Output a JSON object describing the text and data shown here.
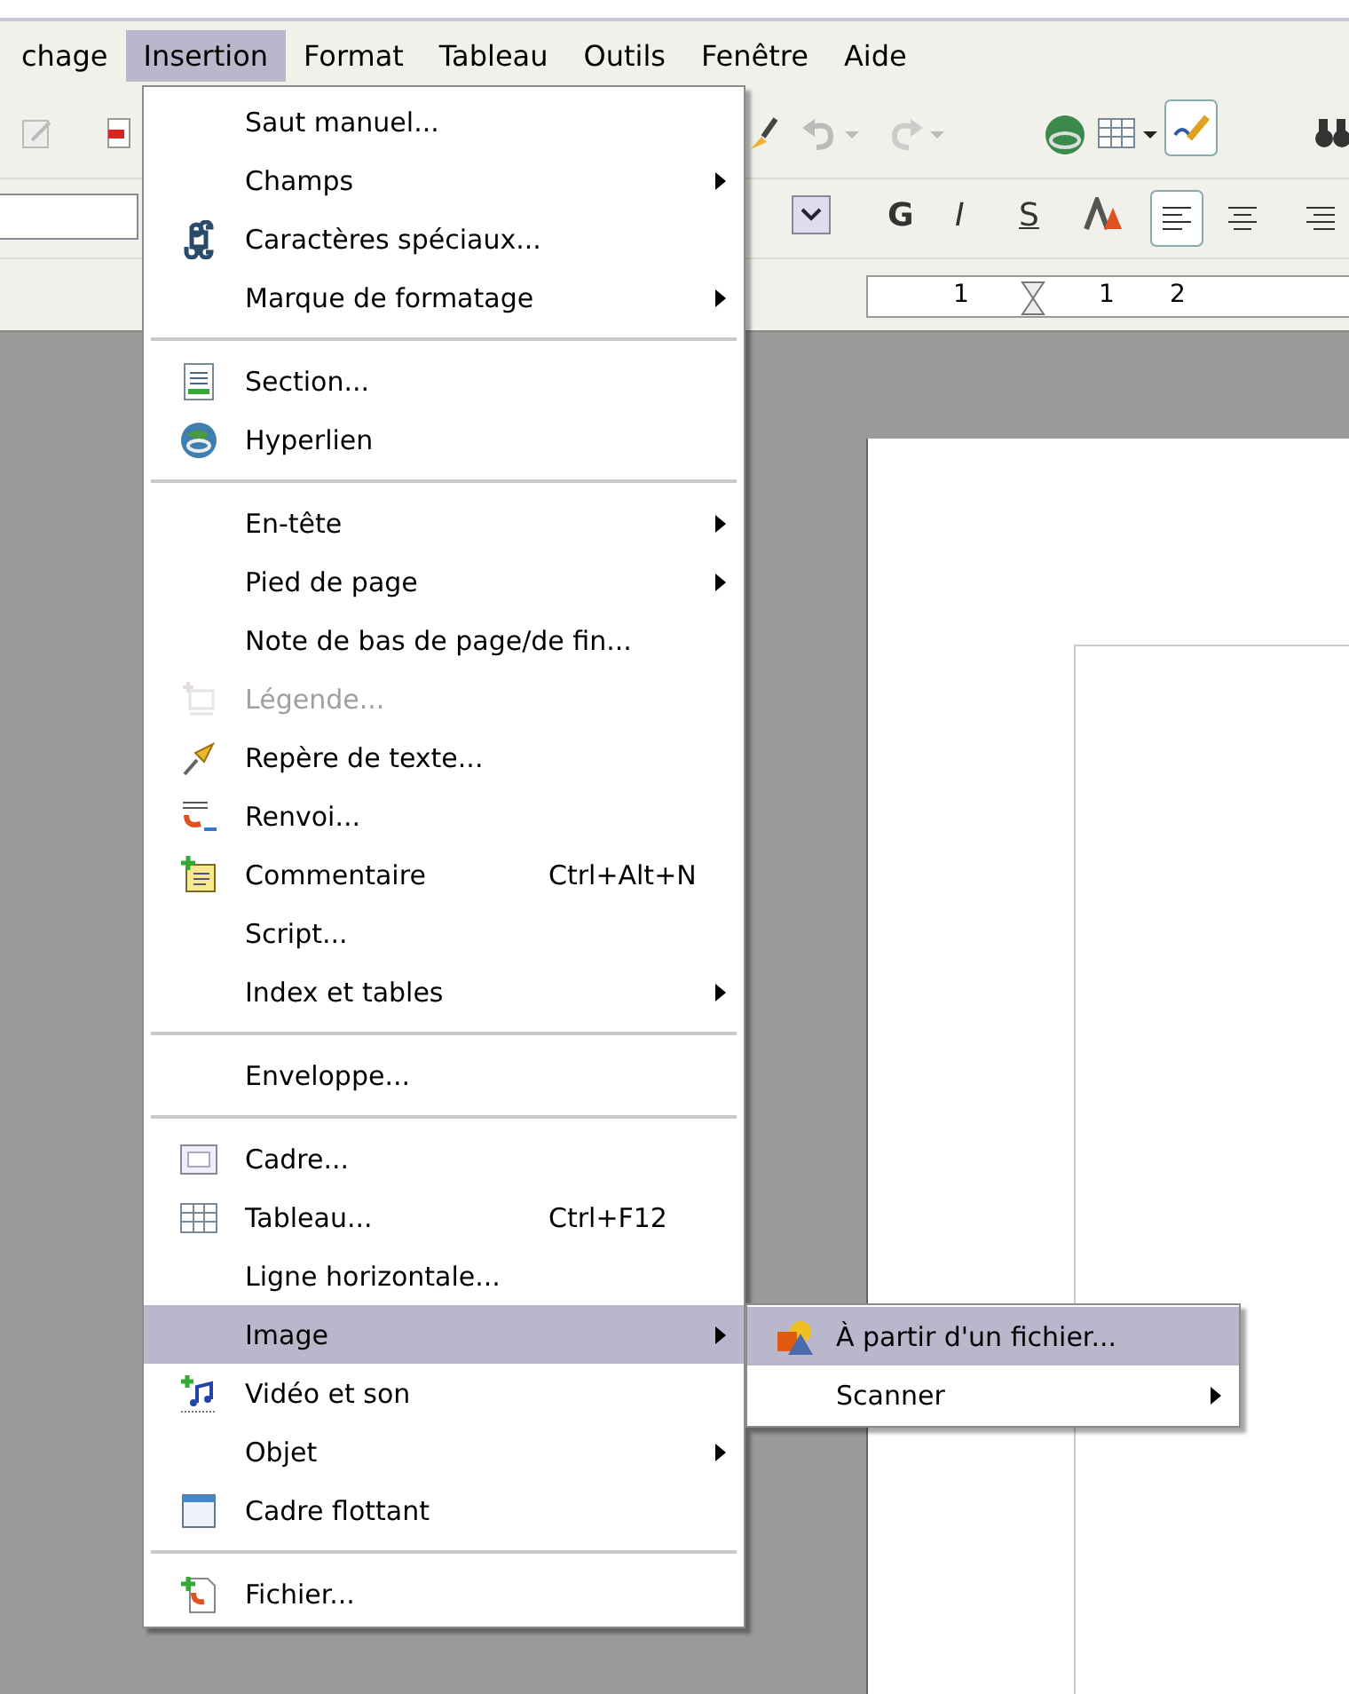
{
  "menubar": [
    {
      "label": "chage",
      "selected": false
    },
    {
      "label": "Insertion",
      "selected": true
    },
    {
      "label": "Format",
      "selected": false
    },
    {
      "label": "Tableau",
      "selected": false
    },
    {
      "label": "Outils",
      "selected": false
    },
    {
      "label": "Fenêtre",
      "selected": false
    },
    {
      "label": "Aide",
      "selected": false
    }
  ],
  "formatting": {
    "bold": "G",
    "italic": "I",
    "shadow": "S"
  },
  "ruler": {
    "labels": [
      "1",
      "1",
      "2"
    ]
  },
  "menu": [
    {
      "kind": "item",
      "label": "Saut manuel...",
      "submenu": false,
      "disabled": false,
      "selected": false
    },
    {
      "kind": "item",
      "label": "Champs",
      "submenu": true,
      "disabled": false,
      "selected": false
    },
    {
      "kind": "item",
      "label": "Caractères spéciaux...",
      "submenu": false,
      "disabled": false,
      "selected": false
    },
    {
      "kind": "item",
      "label": "Marque de formatage",
      "submenu": true,
      "disabled": false,
      "selected": false
    },
    {
      "kind": "separator"
    },
    {
      "kind": "item",
      "label": "Section...",
      "submenu": false,
      "disabled": false,
      "selected": false
    },
    {
      "kind": "item",
      "label": "Hyperlien",
      "submenu": false,
      "disabled": false,
      "selected": false
    },
    {
      "kind": "separator"
    },
    {
      "kind": "item",
      "label": "En-tête",
      "submenu": true,
      "disabled": false,
      "selected": false
    },
    {
      "kind": "item",
      "label": "Pied de page",
      "submenu": true,
      "disabled": false,
      "selected": false
    },
    {
      "kind": "item",
      "label": "Note de bas de page/de fin...",
      "submenu": false,
      "disabled": false,
      "selected": false
    },
    {
      "kind": "item",
      "label": "Légende...",
      "submenu": false,
      "disabled": true,
      "selected": false
    },
    {
      "kind": "item",
      "label": "Repère de texte...",
      "submenu": false,
      "disabled": false,
      "selected": false
    },
    {
      "kind": "item",
      "label": "Renvoi...",
      "submenu": false,
      "disabled": false,
      "selected": false
    },
    {
      "kind": "item",
      "label": "Commentaire",
      "shortcut": "Ctrl+Alt+N",
      "submenu": false,
      "disabled": false,
      "selected": false
    },
    {
      "kind": "item",
      "label": "Script...",
      "submenu": false,
      "disabled": false,
      "selected": false
    },
    {
      "kind": "item",
      "label": "Index et tables",
      "submenu": true,
      "disabled": false,
      "selected": false
    },
    {
      "kind": "separator"
    },
    {
      "kind": "item",
      "label": "Enveloppe...",
      "submenu": false,
      "disabled": false,
      "selected": false
    },
    {
      "kind": "separator"
    },
    {
      "kind": "item",
      "label": "Cadre...",
      "submenu": false,
      "disabled": false,
      "selected": false
    },
    {
      "kind": "item",
      "label": "Tableau...",
      "shortcut": "Ctrl+F12",
      "submenu": false,
      "disabled": false,
      "selected": false
    },
    {
      "kind": "item",
      "label": "Ligne horizontale...",
      "submenu": false,
      "disabled": false,
      "selected": false
    },
    {
      "kind": "item",
      "label": "Image",
      "submenu": true,
      "disabled": false,
      "selected": true
    },
    {
      "kind": "item",
      "label": "Vidéo et son",
      "submenu": false,
      "disabled": false,
      "selected": false
    },
    {
      "kind": "item",
      "label": "Objet",
      "submenu": true,
      "disabled": false,
      "selected": false
    },
    {
      "kind": "item",
      "label": "Cadre flottant",
      "submenu": false,
      "disabled": false,
      "selected": false
    },
    {
      "kind": "separator"
    },
    {
      "kind": "item",
      "label": "Fichier...",
      "submenu": false,
      "disabled": false,
      "selected": false
    }
  ],
  "submenu": [
    {
      "label": "À partir d'un fichier...",
      "submenu": false,
      "selected": true
    },
    {
      "label": "Scanner",
      "submenu": true,
      "selected": false
    }
  ]
}
